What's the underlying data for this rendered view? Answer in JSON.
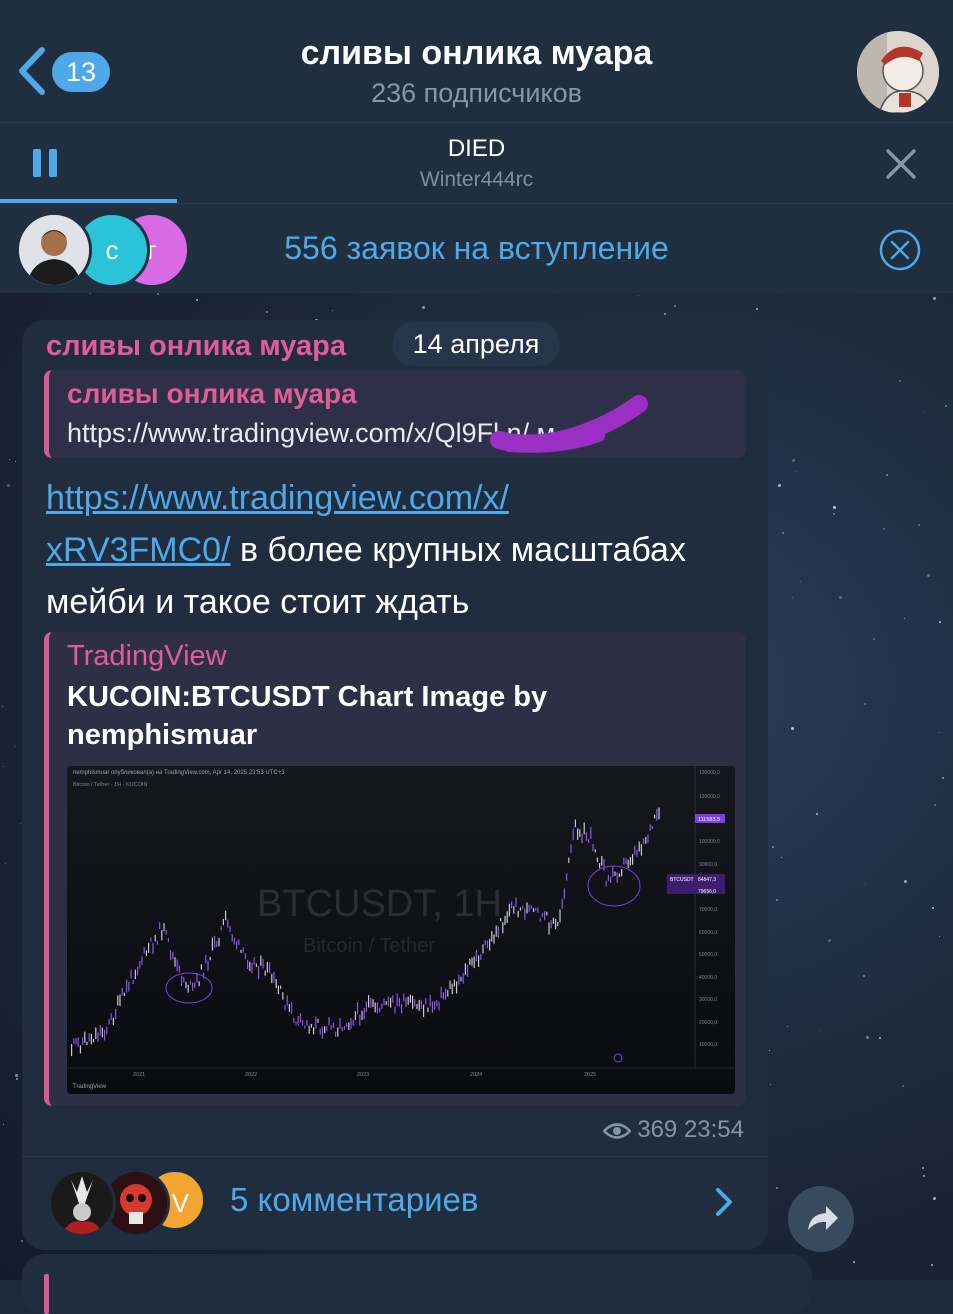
{
  "header": {
    "back_count": "13",
    "title": "сливы онлика муара",
    "subtitle": "236 подписчиков"
  },
  "player": {
    "title": "DIED",
    "artist": "Winter444rc",
    "progress": 0.19
  },
  "requests": {
    "avatars": [
      "с",
      "г"
    ],
    "text": "556 заявок на вступление"
  },
  "message": {
    "sender": "сливы онлика муара",
    "date": "14 апреля",
    "reply": {
      "name": "сливы онлика муара",
      "text": "https://www.tradingview.com/x/Ql9Fl        n/ м..."
    },
    "link": "https://www.tradingview.com/x/xRV3FMC0/",
    "link_line1": "https://www.tradingview.com/x/",
    "link_line2": "xRV3FMC0/",
    "text_after_link": " в более крупных масштабах мейби и такое стоит ждать",
    "preview": {
      "site": "TradingView",
      "title": "KUCOIN:BTCUSDT Chart Image by nemphismuar"
    },
    "views": "369",
    "time": "23:54",
    "comments": {
      "avatar_letter": "V",
      "text": "5 комментариев"
    }
  },
  "chart_image": {
    "header_line": "nemphismuar опубликовал(а) на TradingView.com, Apr 14, 2025 23:53 UTC+3",
    "legend": "Bitcoin / Tether · 1H · KUCOIN",
    "watermark": "BTCUSDT, 1H",
    "watermark_sub": "Bitcoin / Tether",
    "years": [
      "2021",
      "2022",
      "2023",
      "2024",
      "2025"
    ],
    "y_ticks": [
      "130000,0",
      "120000,0",
      "100000,0",
      "90000,0",
      "70000,0",
      "60000,0",
      "50000,0",
      "40000,0",
      "30000,0",
      "20000,0",
      "10000,0"
    ],
    "price_tags": [
      "111583,5",
      "BTCUSDT",
      "84847,3",
      "79656,0"
    ],
    "logo": "TradingView",
    "accent": "#7b3fe4"
  },
  "colors": {
    "accent": "#4fa8e8",
    "sender": "#e05d9a",
    "bubble": "#1f2d3f"
  }
}
